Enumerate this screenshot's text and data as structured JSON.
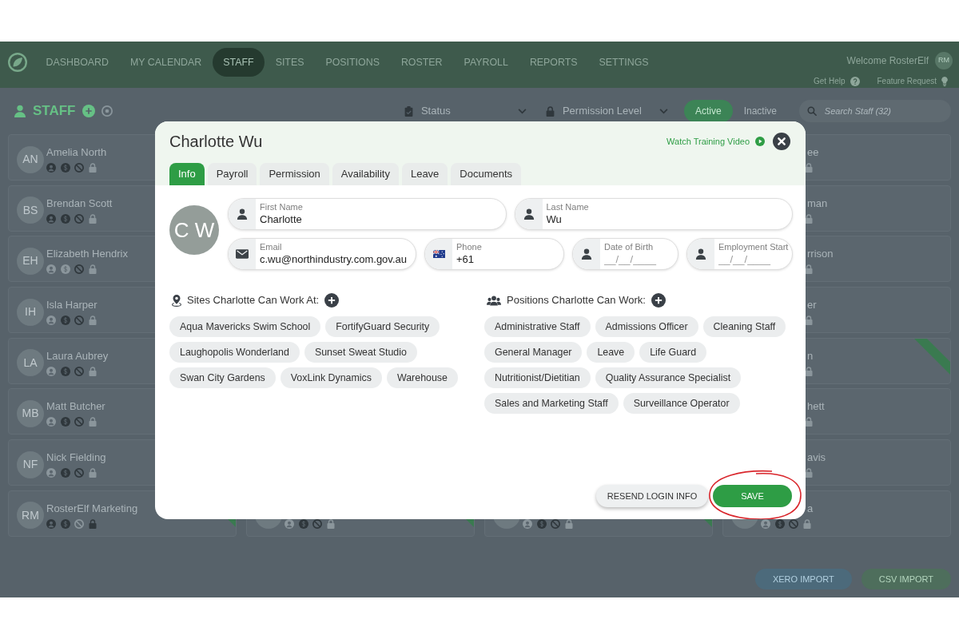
{
  "nav": {
    "items": [
      {
        "label": "DASHBOARD",
        "selected": false
      },
      {
        "label": "MY CALENDAR",
        "selected": false
      },
      {
        "label": "STAFF",
        "selected": true
      },
      {
        "label": "SITES",
        "selected": false
      },
      {
        "label": "POSITIONS",
        "selected": false
      },
      {
        "label": "ROSTER",
        "selected": false
      },
      {
        "label": "PAYROLL",
        "selected": false
      },
      {
        "label": "REPORTS",
        "selected": false
      },
      {
        "label": "SETTINGS",
        "selected": false
      }
    ],
    "welcome": "Welcome RosterElf",
    "user_initials": "RM",
    "links": [
      {
        "label": "Get Help",
        "kind": "help"
      },
      {
        "label": "Feature Request",
        "kind": "idea"
      }
    ]
  },
  "staff_toolbar": {
    "title": "STAFF",
    "filters": [
      {
        "label": "Status",
        "kind": "status"
      },
      {
        "label": "Permission Level",
        "kind": "permission"
      }
    ],
    "toggle": [
      {
        "label": "Active",
        "selected": true
      },
      {
        "label": "Inactive",
        "selected": false
      }
    ],
    "search": {
      "placeholder": "Search Staff (32)"
    }
  },
  "left_column": [
    {
      "initials": "AN",
      "name": "Amelia North",
      "ribbon": false,
      "icons": [
        {
          "kind": "profile",
          "on": true
        },
        {
          "kind": "payroll",
          "on": true
        },
        {
          "kind": "blocked",
          "on": true
        },
        {
          "kind": "lock",
          "on": false
        }
      ]
    },
    {
      "initials": "BS",
      "name": "Brendan Scott",
      "ribbon": false,
      "icons": [
        {
          "kind": "profile",
          "on": true
        },
        {
          "kind": "payroll",
          "on": true
        },
        {
          "kind": "blocked",
          "on": true
        },
        {
          "kind": "lock",
          "on": false
        }
      ]
    },
    {
      "initials": "EH",
      "name": "Elizabeth Hendrix",
      "ribbon": false,
      "icons": [
        {
          "kind": "profile",
          "on": false
        },
        {
          "kind": "payroll",
          "on": false
        },
        {
          "kind": "blocked",
          "on": true
        },
        {
          "kind": "lock",
          "on": false
        }
      ]
    },
    {
      "initials": "IH",
      "name": "Isla Harper",
      "ribbon": false,
      "icons": [
        {
          "kind": "profile",
          "on": false
        },
        {
          "kind": "payroll",
          "on": true
        },
        {
          "kind": "blocked",
          "on": true
        },
        {
          "kind": "lock",
          "on": false
        }
      ]
    },
    {
      "initials": "LA",
      "name": "Laura Aubrey",
      "ribbon": false,
      "icons": [
        {
          "kind": "profile",
          "on": false
        },
        {
          "kind": "payroll",
          "on": true
        },
        {
          "kind": "blocked",
          "on": true
        },
        {
          "kind": "lock",
          "on": false
        }
      ]
    },
    {
      "initials": "MB",
      "name": "Matt Butcher",
      "ribbon": false,
      "icons": [
        {
          "kind": "profile",
          "on": false
        },
        {
          "kind": "payroll",
          "on": true
        },
        {
          "kind": "blocked",
          "on": true
        },
        {
          "kind": "lock",
          "on": false
        }
      ]
    },
    {
      "initials": "NF",
      "name": "Nick Fielding",
      "ribbon": false,
      "icons": [
        {
          "kind": "profile",
          "on": false
        },
        {
          "kind": "payroll",
          "on": true
        },
        {
          "kind": "blocked",
          "on": true
        },
        {
          "kind": "lock",
          "on": false
        }
      ]
    },
    {
      "initials": "RM",
      "name": "RosterElf Marketing",
      "ribbon": true,
      "icons": [
        {
          "kind": "profile",
          "on": true
        },
        {
          "kind": "payroll",
          "on": true
        },
        {
          "kind": "blocked",
          "on": false
        },
        {
          "kind": "lock",
          "on": true
        }
      ]
    }
  ],
  "right_column": [
    {
      "name": "ee",
      "ribbon": false,
      "icons": [
        {
          "kind": "lock",
          "on": false
        }
      ]
    },
    {
      "name": "man",
      "ribbon": false,
      "icons": [
        {
          "kind": "lock",
          "on": false
        }
      ]
    },
    {
      "name": "rrison",
      "ribbon": false,
      "icons": [
        {
          "kind": "lock",
          "on": false
        }
      ]
    },
    {
      "name": "er",
      "ribbon": false,
      "icons": [
        {
          "kind": "lock",
          "on": false
        }
      ]
    },
    {
      "name": "n",
      "ribbon": true,
      "icons": [
        {
          "kind": "lock",
          "on": false
        }
      ]
    },
    {
      "name": "hett",
      "ribbon": false,
      "icons": [
        {
          "kind": "lock",
          "on": false
        }
      ]
    },
    {
      "name": "avis",
      "ribbon": false,
      "icons": [
        {
          "kind": "lock",
          "on": false
        }
      ]
    }
  ],
  "bottom_row": [
    {
      "ribbon": true,
      "icons": [
        {
          "kind": "profile",
          "on": false
        },
        {
          "kind": "payroll",
          "on": true
        },
        {
          "kind": "blocked",
          "on": true
        },
        {
          "kind": "lock",
          "on": false
        }
      ]
    },
    {
      "ribbon": true,
      "icons": [
        {
          "kind": "profile",
          "on": false
        },
        {
          "kind": "payroll",
          "on": true
        },
        {
          "kind": "blocked",
          "on": true
        },
        {
          "kind": "lock",
          "on": false
        }
      ]
    },
    {
      "name": "a",
      "ribbon": false,
      "icons": [
        {
          "kind": "profile",
          "on": false
        },
        {
          "kind": "payroll",
          "on": true
        },
        {
          "kind": "blocked",
          "on": true
        },
        {
          "kind": "lock",
          "on": false
        }
      ]
    }
  ],
  "import_buttons": [
    {
      "label": "XERO IMPORT",
      "kind": "xero"
    },
    {
      "label": "CSV IMPORT",
      "kind": "csv"
    }
  ],
  "modal": {
    "title": "Charlotte Wu",
    "training_link": "Watch Training Video",
    "tabs": [
      {
        "label": "Info",
        "selected": true
      },
      {
        "label": "Payroll",
        "selected": false
      },
      {
        "label": "Permission",
        "selected": false
      },
      {
        "label": "Availability",
        "selected": false
      },
      {
        "label": "Leave",
        "selected": false
      },
      {
        "label": "Documents",
        "selected": false
      }
    ],
    "avatar_initials": "C W",
    "field_rows": [
      [
        {
          "label": "First Name",
          "value": "Charlotte",
          "kind": "name"
        },
        {
          "label": "Last Name",
          "value": "Wu",
          "kind": "name"
        }
      ],
      [
        {
          "label": "Email",
          "value": "c.wu@northindustry.com.gov.au",
          "kind": "email"
        },
        {
          "label": "Phone",
          "value": "+61",
          "kind": "phone"
        },
        {
          "label": "Date of Birth",
          "placeholder": "__/__/____",
          "kind": "date"
        },
        {
          "label": "Employment Start",
          "placeholder": "__/__/____",
          "kind": "date"
        }
      ]
    ],
    "sites": {
      "heading": "Sites Charlotte Can Work At:",
      "items": [
        "Aqua Mavericks Swim School",
        "FortifyGuard Security",
        "Laughopolis Wonderland",
        "Sunset Sweat Studio",
        "Swan City Gardens",
        "VoxLink Dynamics",
        "Warehouse"
      ]
    },
    "positions": {
      "heading": "Positions Charlotte Can Work:",
      "items": [
        "Administrative Staff",
        "Admissions Officer",
        "Cleaning Staff",
        "General Manager",
        "Leave",
        "Life Guard",
        "Nutritionist/Dietitian",
        "Quality Assurance Specialist",
        "Sales and Marketing Staff",
        "Surveillance Operator"
      ]
    },
    "buttons": [
      {
        "label": "RESEND LOGIN INFO",
        "kind": "secondary",
        "circled": false
      },
      {
        "label": "SAVE",
        "kind": "primary",
        "circled": true
      }
    ]
  }
}
